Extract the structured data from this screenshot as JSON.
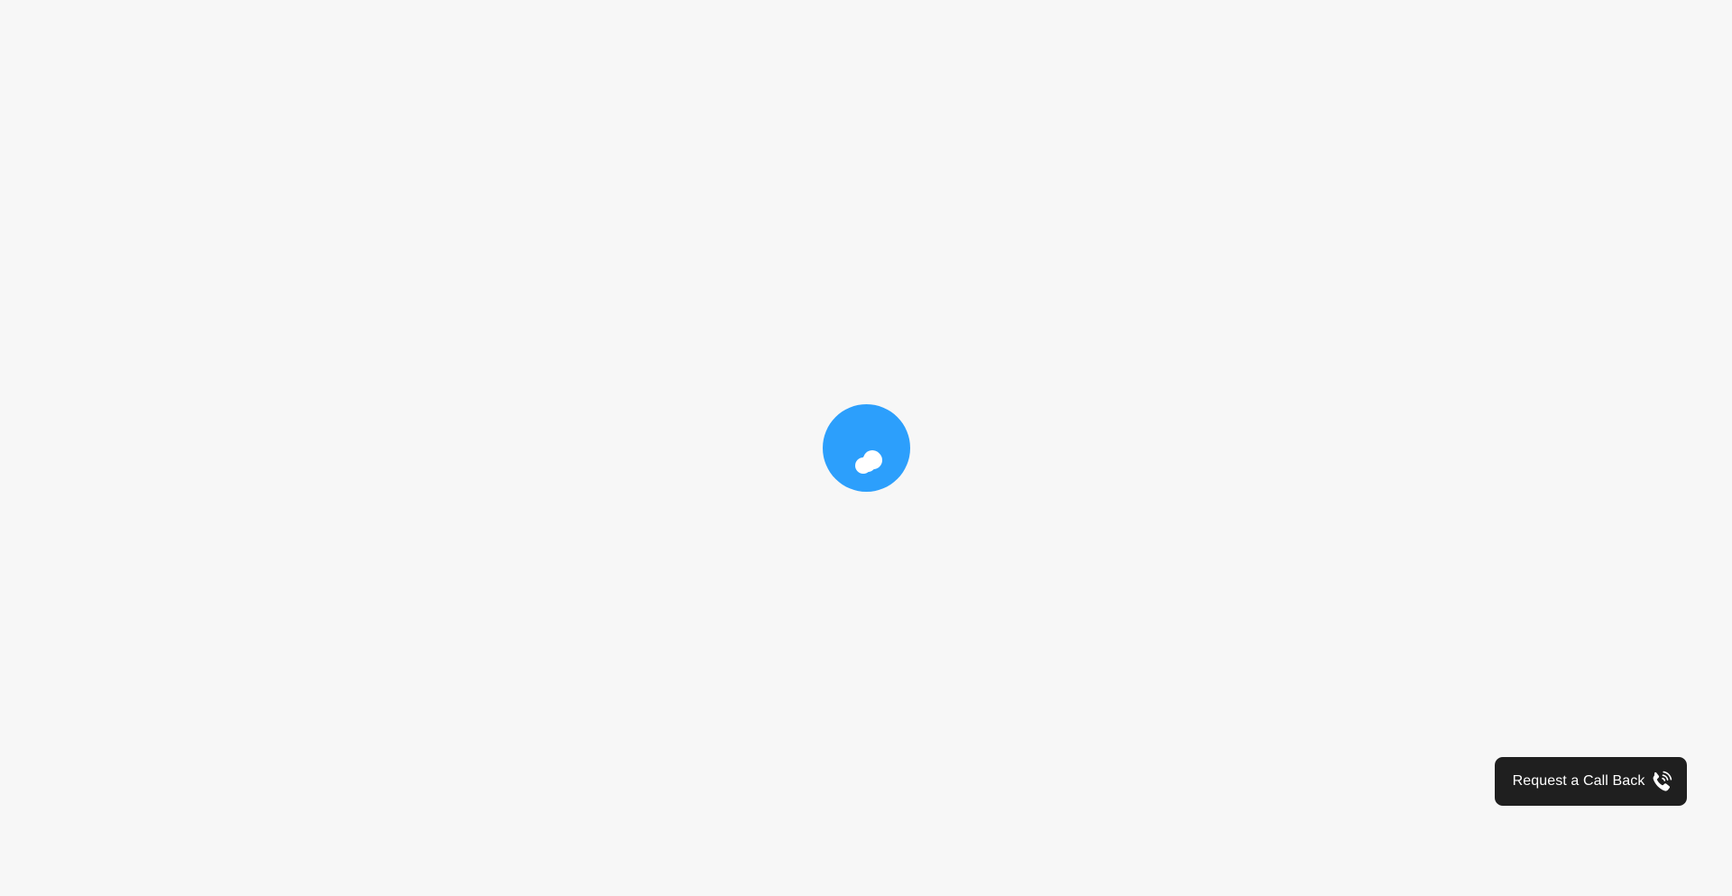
{
  "loader": {
    "icon": "loading-spinner-icon",
    "color": "#2c9ffc"
  },
  "callback": {
    "label": "Request a Call Back",
    "icon": "phone-ringing-icon",
    "background": "#1f1f1f",
    "text_color": "#ffffff"
  },
  "page": {
    "background": "#f7f7f7"
  }
}
